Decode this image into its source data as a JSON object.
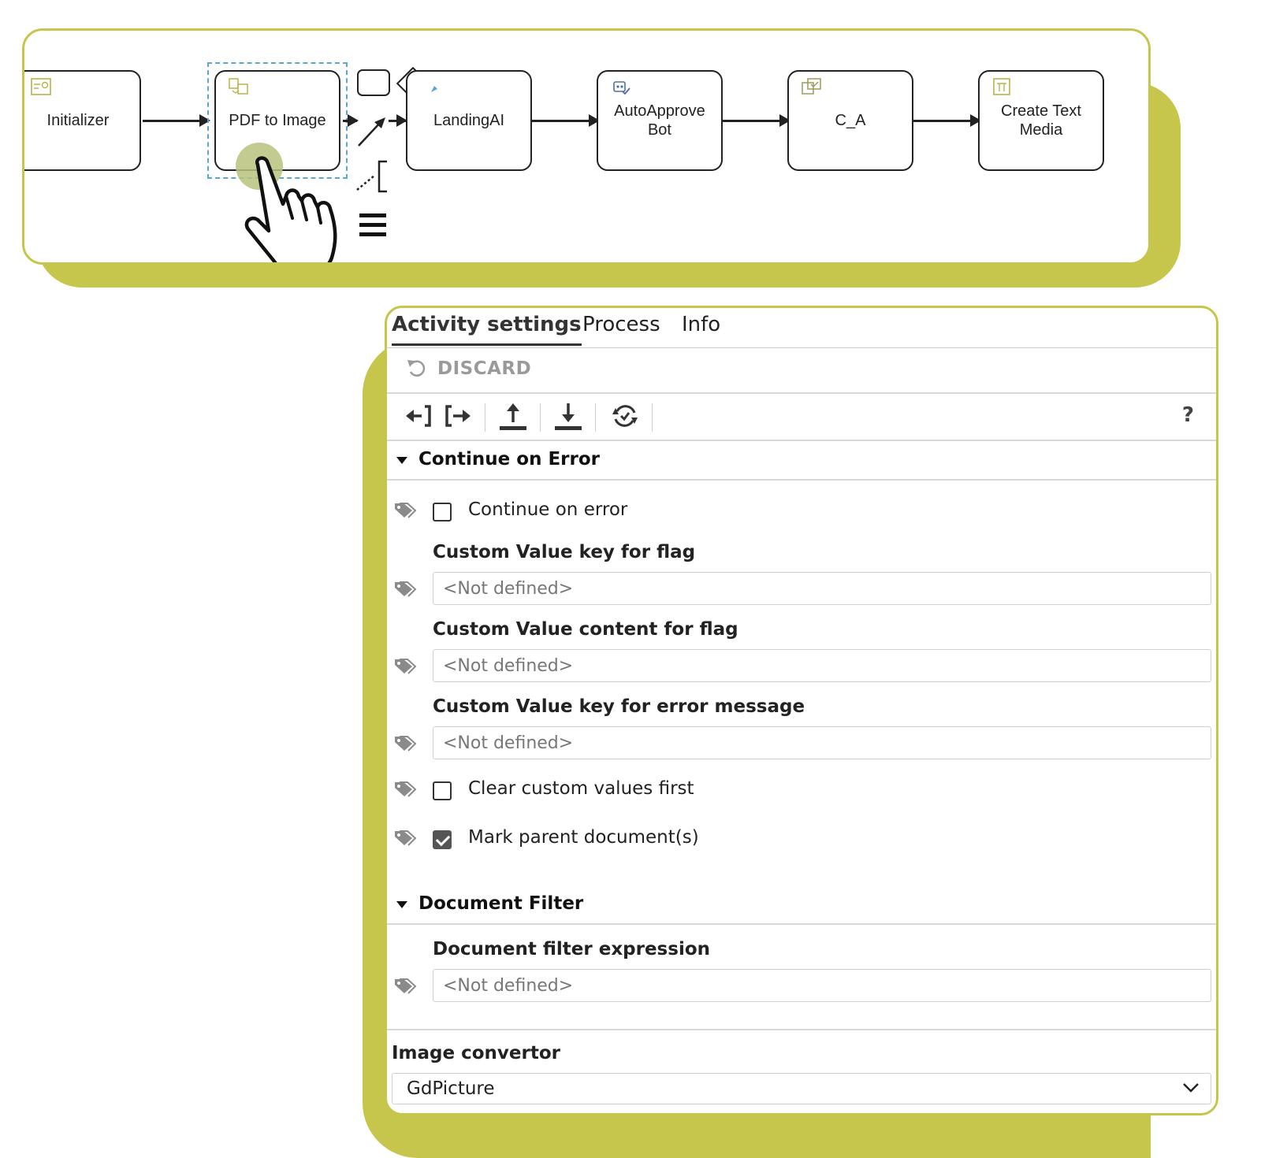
{
  "workflow": {
    "nodes": [
      {
        "id": "initializer",
        "label": "Initializer"
      },
      {
        "id": "pdf-to-image",
        "label": "PDF to Image"
      },
      {
        "id": "landingai",
        "label": "LandingAI"
      },
      {
        "id": "autoapprove-bot",
        "label": "AutoApprove\nBot"
      },
      {
        "id": "c-a",
        "label": "C_A"
      },
      {
        "id": "create-text-media",
        "label": "Create Text\nMedia"
      }
    ],
    "selected_node": "pdf-to-image"
  },
  "panel": {
    "tabs": [
      {
        "label": "Activity settings",
        "active": true
      },
      {
        "label": "Process",
        "active": false
      },
      {
        "label": "Info",
        "active": false
      }
    ],
    "discard_label": "DISCARD",
    "help_label": "?",
    "sections": {
      "continue_on_error": {
        "title": "Continue on Error",
        "continue_on_error_label": "Continue on error",
        "continue_on_error_checked": false,
        "key_flag_label": "Custom Value key for flag",
        "key_flag_placeholder": "<Not defined>",
        "content_flag_label": "Custom Value content for flag",
        "content_flag_placeholder": "<Not defined>",
        "key_error_label": "Custom Value key for error message",
        "key_error_placeholder": "<Not defined>",
        "clear_custom_label": "Clear custom values first",
        "clear_custom_checked": false,
        "mark_parent_label": "Mark parent document(s)",
        "mark_parent_checked": true
      },
      "document_filter": {
        "title": "Document Filter",
        "expression_label": "Document filter expression",
        "expression_placeholder": "<Not defined>"
      }
    },
    "image_convertor": {
      "label": "Image convertor",
      "value": "GdPicture"
    }
  },
  "colors": {
    "accent": "#c5c64b",
    "selection": "#5aa6d6"
  }
}
